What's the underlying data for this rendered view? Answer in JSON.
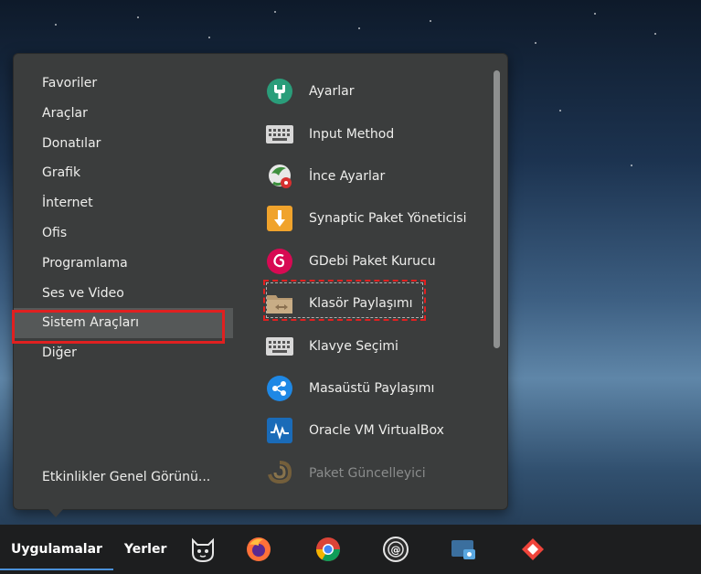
{
  "categories": [
    {
      "label": "Favoriler"
    },
    {
      "label": "Araçlar"
    },
    {
      "label": "Donatılar"
    },
    {
      "label": "Grafik"
    },
    {
      "label": "İnternet"
    },
    {
      "label": "Ofis"
    },
    {
      "label": "Programlama"
    },
    {
      "label": "Ses ve Video"
    },
    {
      "label": "Sistem Araçları",
      "selected": true
    },
    {
      "label": "Diğer"
    }
  ],
  "overview_label": "Etkinlikler Genel Görünü...",
  "apps": [
    {
      "label": "Ayarlar",
      "icon": "settings-icon"
    },
    {
      "label": "Input Method",
      "icon": "keyboard-icon"
    },
    {
      "label": "İnce Ayarlar",
      "icon": "tweaks-icon"
    },
    {
      "label": "Synaptic Paket Yöneticisi",
      "icon": "synaptic-icon"
    },
    {
      "label": "GDebi Paket Kurucu",
      "icon": "gdebi-icon"
    },
    {
      "label": "Klasör Paylaşımı",
      "icon": "folder-share-icon",
      "highlighted": true
    },
    {
      "label": "Klavye Seçimi",
      "icon": "keyboard-icon"
    },
    {
      "label": "Masaüstü Paylaşımı",
      "icon": "desktop-share-icon"
    },
    {
      "label": "Oracle VM VirtualBox",
      "icon": "virtualbox-icon"
    },
    {
      "label": "Paket Güncelleyici",
      "icon": "updater-icon",
      "dimmed": true
    }
  ],
  "taskbar": {
    "applications_label": "Uygulamalar",
    "places_label": "Yerler",
    "launchers": [
      "pardus-icon",
      "firefox-icon",
      "chrome-icon",
      "mail-icon",
      "screenshot-icon",
      "anydesk-icon"
    ]
  },
  "colors": {
    "highlight": "#e02020",
    "menu_bg": "#3b3d3d",
    "selected_bg": "#555858",
    "taskbar_bg": "#1d1e1f"
  }
}
